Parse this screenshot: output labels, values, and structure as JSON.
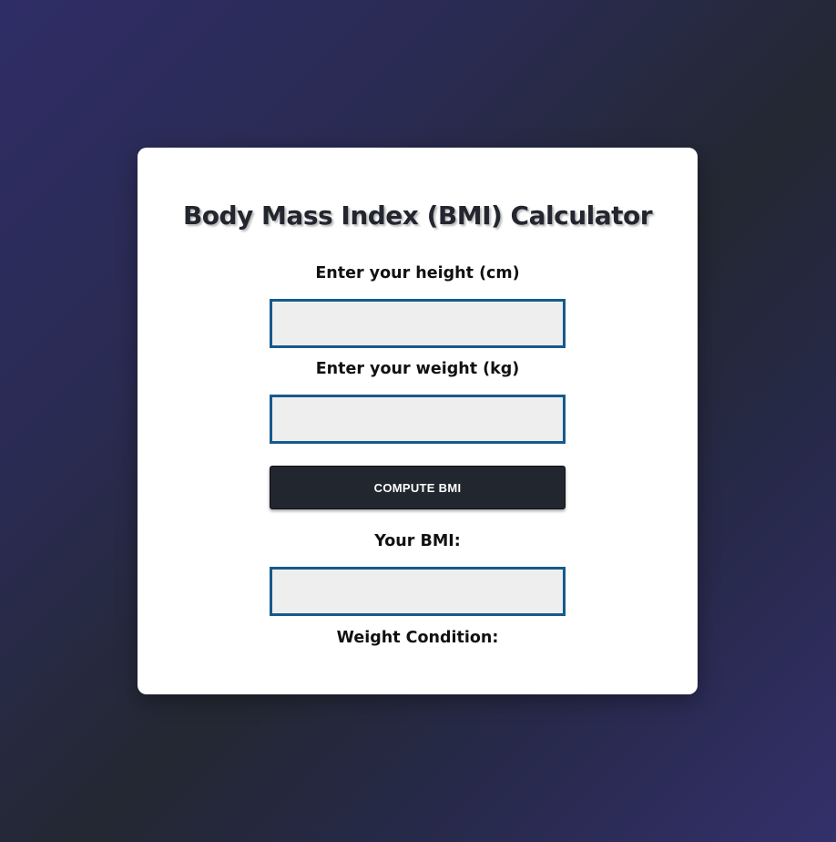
{
  "calculator": {
    "title": "Body Mass Index (BMI) Calculator",
    "height_label": "Enter your height (cm)",
    "height_value": "",
    "weight_label": "Enter your weight (kg)",
    "weight_value": "",
    "compute_button_label": "COMPUTE BMI",
    "bmi_label": "Your BMI:",
    "bmi_value": "",
    "condition_label": "Weight Condition:",
    "condition_value": ""
  },
  "colors": {
    "background_gradient": [
      "#2f2d66",
      "#232832",
      "#33306b"
    ],
    "card": "#ffffff",
    "input_border": "#165a8c",
    "input_fill": "#eeeeee",
    "button": "#22262e",
    "title_text": "#23262f"
  }
}
